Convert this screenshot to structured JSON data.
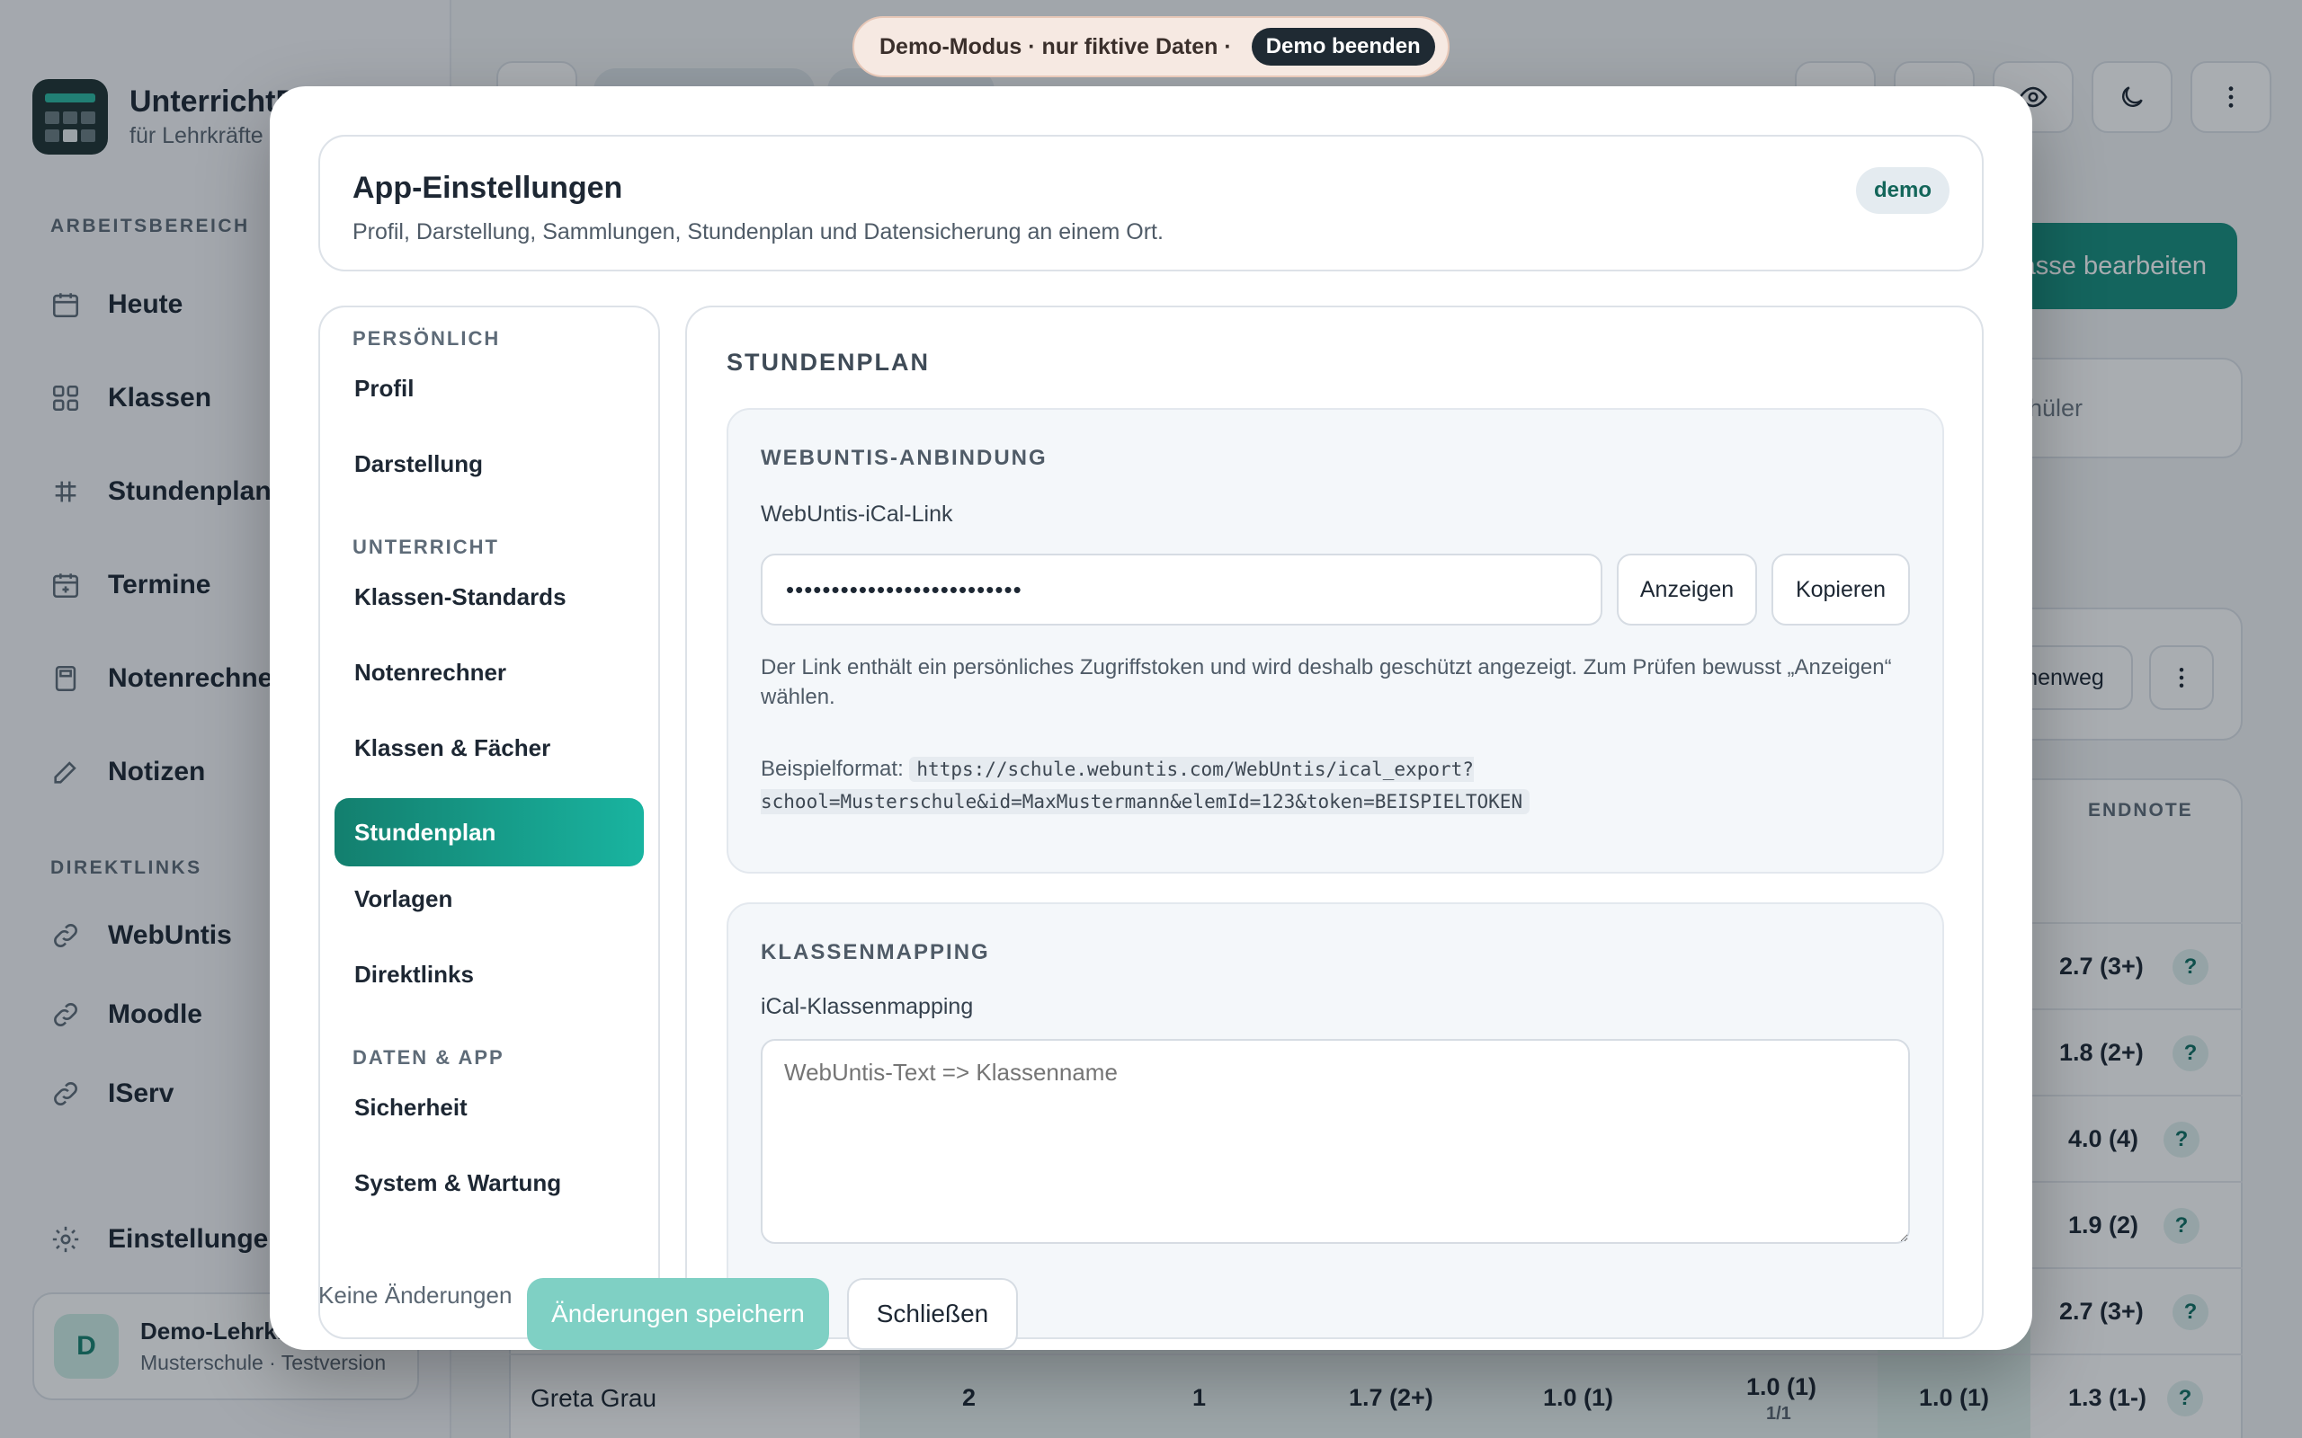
{
  "brand": {
    "title": "UnterrichtP",
    "subtitle": "für Lehrkräfte"
  },
  "sidebar": {
    "section_work": "ARBEITSBEREICH",
    "items": [
      {
        "label": "Heute",
        "icon": "calendar-icon"
      },
      {
        "label": "Klassen",
        "icon": "grid-icon"
      },
      {
        "label": "Stundenplan",
        "icon": "timetable-icon"
      },
      {
        "label": "Termine",
        "icon": "calendar-plus-icon"
      },
      {
        "label": "Notenrechner",
        "icon": "calculator-icon"
      },
      {
        "label": "Notizen",
        "icon": "pencil-icon"
      }
    ],
    "section_links": "DIREKTLINKS",
    "links": [
      {
        "label": "WebUntis",
        "icon": "link-icon"
      },
      {
        "label": "Moodle",
        "icon": "link-icon"
      },
      {
        "label": "IServ",
        "icon": "link-icon"
      }
    ],
    "settings_label": "Einstellungen",
    "user": {
      "initial": "D",
      "name": "Demo-Lehrkr",
      "school": "Musterschule · Testversion"
    }
  },
  "demo_banner": {
    "text": "Demo-Modus · nur fiktive Daten ·",
    "end_label": "Demo beenden"
  },
  "background": {
    "edit_button": "asse bearbeiten",
    "search_placeholder": "hüler",
    "filter_button": "henweg",
    "endnote_header": "ENDNOTE",
    "endnotes": [
      "2.7 (3+)",
      "1.8 (2+)",
      "4.0 (4)",
      "1.9 (2)",
      "2.7 (3+)"
    ],
    "last_row": {
      "name": "Greta Grau",
      "c1": "2",
      "c2": "1",
      "c3": "1.7 (2+)",
      "c4": "1.0 (1)",
      "c5": "1.0 (1)",
      "c5_sub": "1/1",
      "c6": "1.0 (1)",
      "c7": "1.3 (1-)"
    },
    "help_mark": "?"
  },
  "modal": {
    "title": "App-Einstellungen",
    "subtitle": "Profil, Darstellung, Sammlungen, Stundenplan und Datensicherung an einem Ort.",
    "badge": "demo",
    "nav": {
      "sec_personal": "PERSÖNLICH",
      "profile": "Profil",
      "appearance": "Darstellung",
      "sec_teaching": "UNTERRICHT",
      "class_defaults": "Klassen-Standards",
      "grade_calc": "Notenrechner",
      "classes_subjects": "Klassen & Fächer",
      "timetable": "Stundenplan",
      "templates": "Vorlagen",
      "direct_links": "Direktlinks",
      "sec_data": "DATEN & APP",
      "security": "Sicherheit",
      "system": "System & Wartung"
    },
    "content": {
      "title": "STUNDENPLAN",
      "webuntis": {
        "title": "WEBUNTIS-ANBINDUNG",
        "label": "WebUntis-iCal-Link",
        "masked_value": "••••••••••••••••••••••••••",
        "show_button": "Anzeigen",
        "copy_button": "Kopieren",
        "help": "Der Link enthält ein persönliches Zugriffstoken und wird deshalb geschützt angezeigt. Zum Prüfen bewusst „Anzeigen“ wählen.",
        "example_label": "Beispielformat:",
        "example_url": "https://schule.webuntis.com/WebUntis/ical_export?school=Musterschule&id=MaxMustermann&elemId=123&token=BEISPIELTOKEN"
      },
      "mapping": {
        "title": "KLASSENMAPPING",
        "label": "iCal-Klassenmapping",
        "placeholder": "WebUntis-Text => Klassenname"
      }
    },
    "footer": {
      "status": "Keine Änderungen",
      "save": "Änderungen speichern",
      "close": "Schließen"
    }
  }
}
